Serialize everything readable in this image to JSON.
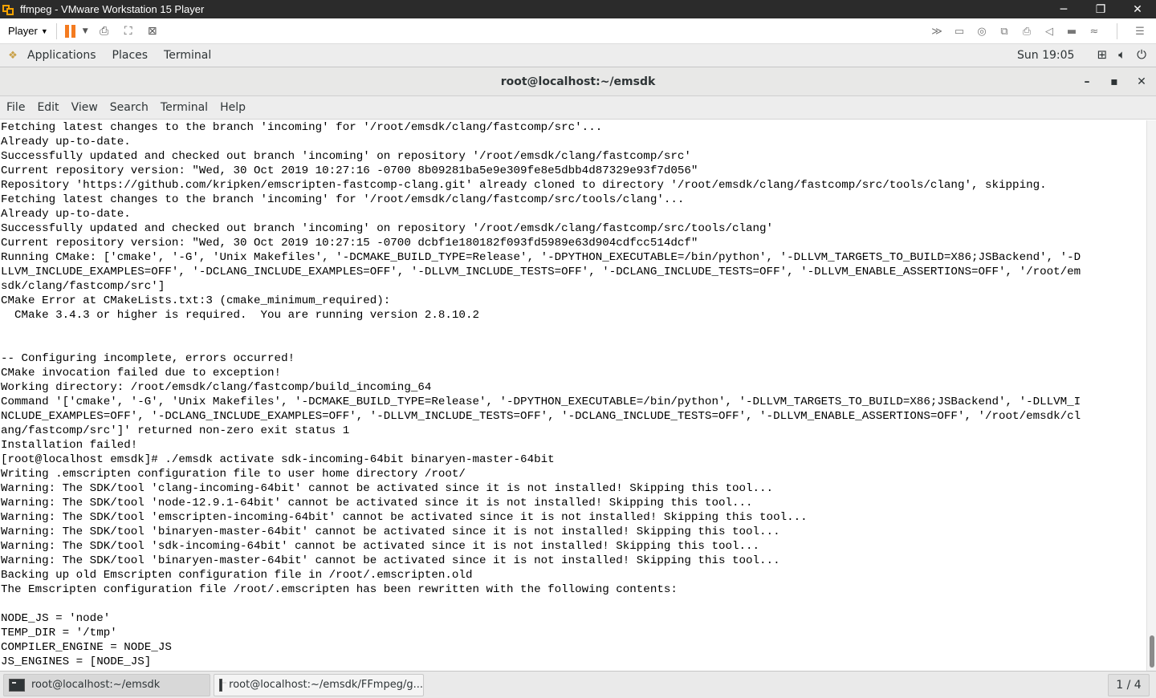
{
  "vmware": {
    "title": "ffmpeg - VMware Workstation 15 Player",
    "player_label": "Player",
    "win_minimize": "─",
    "win_restore": "❐",
    "win_close": "✕"
  },
  "gnome": {
    "applications": "Applications",
    "places": "Places",
    "terminal": "Terminal",
    "clock": "Sun 19:05"
  },
  "terminal_window": {
    "title": "root@localhost:~/emsdk",
    "minimize": "–",
    "maximize": "▪",
    "close": "✕"
  },
  "menubar": {
    "file": "File",
    "edit": "Edit",
    "view": "View",
    "search": "Search",
    "terminal": "Terminal",
    "help": "Help"
  },
  "terminal_lines": [
    "Fetching latest changes to the branch 'incoming' for '/root/emsdk/clang/fastcomp/src'...",
    "Already up-to-date.",
    "Successfully updated and checked out branch 'incoming' on repository '/root/emsdk/clang/fastcomp/src'",
    "Current repository version: \"Wed, 30 Oct 2019 10:27:16 -0700 8b09281ba5e9e309fe8e5dbb4d87329e93f7d056\"",
    "Repository 'https://github.com/kripken/emscripten-fastcomp-clang.git' already cloned to directory '/root/emsdk/clang/fastcomp/src/tools/clang', skipping.",
    "Fetching latest changes to the branch 'incoming' for '/root/emsdk/clang/fastcomp/src/tools/clang'...",
    "Already up-to-date.",
    "Successfully updated and checked out branch 'incoming' on repository '/root/emsdk/clang/fastcomp/src/tools/clang'",
    "Current repository version: \"Wed, 30 Oct 2019 10:27:15 -0700 dcbf1e180182f093fd5989e63d904cdfcc514dcf\"",
    "Running CMake: ['cmake', '-G', 'Unix Makefiles', '-DCMAKE_BUILD_TYPE=Release', '-DPYTHON_EXECUTABLE=/bin/python', '-DLLVM_TARGETS_TO_BUILD=X86;JSBackend', '-D",
    "LLVM_INCLUDE_EXAMPLES=OFF', '-DCLANG_INCLUDE_EXAMPLES=OFF', '-DLLVM_INCLUDE_TESTS=OFF', '-DCLANG_INCLUDE_TESTS=OFF', '-DLLVM_ENABLE_ASSERTIONS=OFF', '/root/em",
    "sdk/clang/fastcomp/src']",
    "CMake Error at CMakeLists.txt:3 (cmake_minimum_required):",
    "  CMake 3.4.3 or higher is required.  You are running version 2.8.10.2",
    "",
    "",
    "-- Configuring incomplete, errors occurred!",
    "CMake invocation failed due to exception!",
    "Working directory: /root/emsdk/clang/fastcomp/build_incoming_64",
    "Command '['cmake', '-G', 'Unix Makefiles', '-DCMAKE_BUILD_TYPE=Release', '-DPYTHON_EXECUTABLE=/bin/python', '-DLLVM_TARGETS_TO_BUILD=X86;JSBackend', '-DLLVM_I",
    "NCLUDE_EXAMPLES=OFF', '-DCLANG_INCLUDE_EXAMPLES=OFF', '-DLLVM_INCLUDE_TESTS=OFF', '-DCLANG_INCLUDE_TESTS=OFF', '-DLLVM_ENABLE_ASSERTIONS=OFF', '/root/emsdk/cl",
    "ang/fastcomp/src']' returned non-zero exit status 1",
    "Installation failed!",
    "[root@localhost emsdk]# ./emsdk activate sdk-incoming-64bit binaryen-master-64bit",
    "Writing .emscripten configuration file to user home directory /root/",
    "Warning: The SDK/tool 'clang-incoming-64bit' cannot be activated since it is not installed! Skipping this tool...",
    "Warning: The SDK/tool 'node-12.9.1-64bit' cannot be activated since it is not installed! Skipping this tool...",
    "Warning: The SDK/tool 'emscripten-incoming-64bit' cannot be activated since it is not installed! Skipping this tool...",
    "Warning: The SDK/tool 'binaryen-master-64bit' cannot be activated since it is not installed! Skipping this tool...",
    "Warning: The SDK/tool 'sdk-incoming-64bit' cannot be activated since it is not installed! Skipping this tool...",
    "Warning: The SDK/tool 'binaryen-master-64bit' cannot be activated since it is not installed! Skipping this tool...",
    "Backing up old Emscripten configuration file in /root/.emscripten.old",
    "The Emscripten configuration file /root/.emscripten has been rewritten with the following contents:",
    "",
    "NODE_JS = 'node'",
    "TEMP_DIR = '/tmp'",
    "COMPILER_ENGINE = NODE_JS",
    "JS_ENGINES = [NODE_JS]"
  ],
  "taskbar": {
    "task1": "root@localhost:~/emsdk",
    "task2": "root@localhost:~/emsdk/FFmpeg/g...",
    "workspace": "1 / 4"
  },
  "colors": {
    "vm_titlebar": "#2b2b2b",
    "vm_accent": "#f47b20",
    "gnome_bar": "#ededed",
    "terminal_bg": "#ffffff",
    "terminal_fg": "#000000"
  }
}
